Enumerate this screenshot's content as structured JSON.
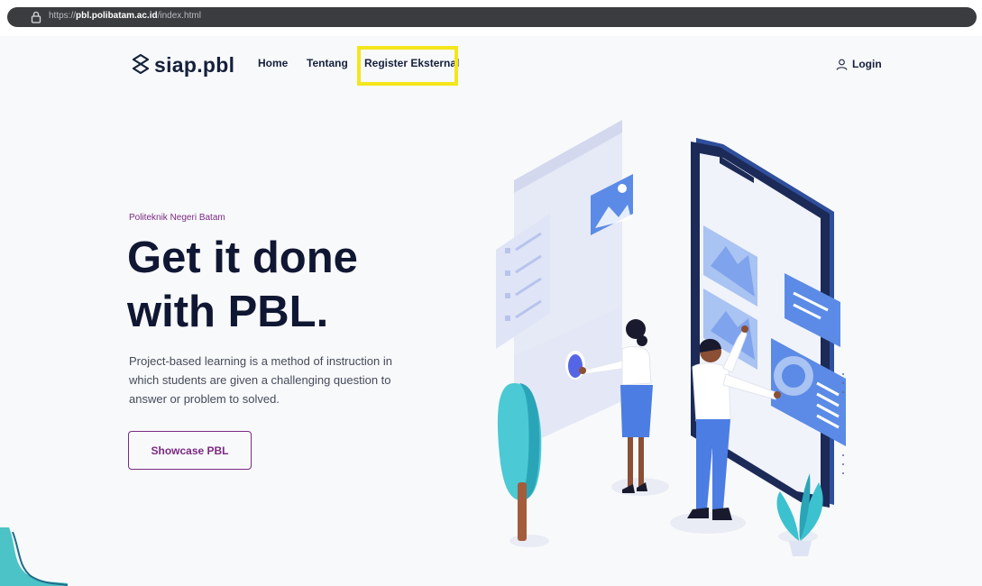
{
  "browser": {
    "url_prefix": "https://",
    "url_host": "pbl.polibatam.ac.id",
    "url_path": "/index.html"
  },
  "brand": {
    "logo_text": "siap.pbl"
  },
  "nav": {
    "home": "Home",
    "tentang": "Tentang",
    "register": "Register Eksternal",
    "login": "Login"
  },
  "hero": {
    "eyebrow": "Politeknik Negeri Batam",
    "title_line1": "Get it done",
    "title_line2": "with PBL.",
    "description": "Project-based learning is a method of instruction in which students are given a challenging question to answer or problem to solved.",
    "cta_label": "Showcase PBL"
  },
  "colors": {
    "primary_text": "#15203b",
    "accent_purple": "#7b2a82",
    "highlight_yellow": "#f4e61c",
    "illustration_blue": "#4a7de0"
  }
}
